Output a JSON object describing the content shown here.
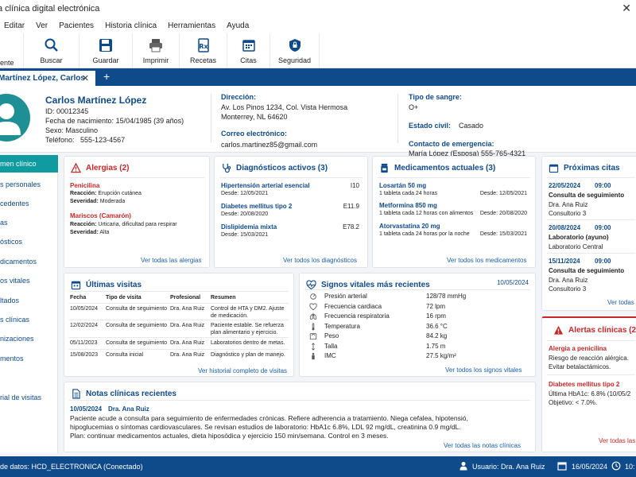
{
  "window": {
    "title": "a clínica digital electrónica",
    "close_glyph": "✕"
  },
  "menu": [
    "Editar",
    "Ver",
    "Pacientes",
    "Historia clínica",
    "Herramientas",
    "Ayuda"
  ],
  "toolbar": [
    {
      "label": "ente",
      "icon": "new-patient-icon"
    },
    {
      "label": "Buscar",
      "icon": "search-icon"
    },
    {
      "label": "Guardar",
      "icon": "save-icon"
    },
    {
      "label": "Imprimir",
      "icon": "printer-icon"
    },
    {
      "label": "Recetas",
      "icon": "prescription-icon"
    },
    {
      "label": "Citas",
      "icon": "calendar-icon"
    },
    {
      "label": "Seguridad",
      "icon": "shield-icon"
    }
  ],
  "tab": {
    "label": "Martínez López, Carlos",
    "close": "✕",
    "add": "+"
  },
  "patient": {
    "name": "Carlos Martínez López",
    "id_label": "ID:",
    "id": "00012345",
    "dob_label": "Fecha de nacimiento:",
    "dob": "15/04/1985 (39 años)",
    "sex_label": "Sexo:",
    "sex": "Masculino",
    "phone_label": "Teléfono:",
    "phone": "555-123-4567",
    "address_label": "Dirección:",
    "address1": "Av. Los Pinos 1234, Col. Vista Hermosa",
    "address2": "Monterrey, NL 64620",
    "email_label": "Correo electrónico:",
    "email": "carlos.martinez85@gmail.com",
    "blood_label": "Tipo de sangre:",
    "blood": "O+",
    "civil_label": "Estado civil:",
    "civil": "Casado",
    "emergency_label": "Contacto de emergencia:",
    "emergency": "María López (Esposa)  555-765-4321"
  },
  "sidebar": [
    "men clínico",
    "s personales",
    "cedentes",
    "as",
    "ósticos",
    "dicamentos",
    "os vitales",
    "ltados",
    "s clínicas",
    "nizaciones",
    "mentos",
    "rial de visitas"
  ],
  "allergies": {
    "title": "Alergias (2)",
    "items": [
      {
        "name": "Penicilina",
        "reaction_label": "Reacción:",
        "reaction": "Erupción cutánea",
        "severity_label": "Severidad:",
        "severity": "Moderada"
      },
      {
        "name": "Mariscos (Camarón)",
        "reaction_label": "Reacción:",
        "reaction": "Urticaria, dificultad para respirar",
        "severity_label": "Severidad:",
        "severity": "Alta"
      }
    ],
    "link": "Ver todas las alergias"
  },
  "diagnoses": {
    "title": "Diagnósticos activos (3)",
    "items": [
      {
        "name": "Hipertensión arterial esencial",
        "code": "I10",
        "since": "Desde: 12/05/2021"
      },
      {
        "name": "Diabetes mellitus tipo 2",
        "code": "E11.9",
        "since": "Desde: 20/08/2020"
      },
      {
        "name": "Dislipidemia mixta",
        "code": "E78.2",
        "since": "Desde: 15/03/2021"
      }
    ],
    "link": "Ver todos los diagnósticos"
  },
  "medications": {
    "title": "Medicamentos actuales (3)",
    "items": [
      {
        "name": "Losartán 50 mg",
        "dose": "1 tableta cada 24 horas",
        "since": "Desde: 12/05/2021"
      },
      {
        "name": "Metformina 850 mg",
        "dose": "1 tableta cada 12 horas con alimentos",
        "since": "Desde: 20/08/2020"
      },
      {
        "name": "Atorvastatina 20 mg",
        "dose": "1 tableta cada 24 horas por la noche",
        "since": "Desde: 15/03/2021"
      }
    ],
    "link": "Ver todos los medicamentos"
  },
  "appointments": {
    "title": "Próximas citas",
    "items": [
      {
        "date": "22/05/2024",
        "time": "09:00",
        "type": "Consulta de seguimiento",
        "doctor": "Dra. Ana Ruiz",
        "room": "Consultorio 3"
      },
      {
        "date": "20/08/2024",
        "time": "09:00",
        "type": "Laboratorio (ayuno)",
        "doctor": "Laboratorio Central",
        "room": ""
      },
      {
        "date": "15/11/2024",
        "time": "09:00",
        "type": "Consulta de seguimiento",
        "doctor": "Dra. Ana Ruiz",
        "room": "Consultorio 3"
      }
    ],
    "link": "Ver todas l"
  },
  "visits": {
    "title": "Últimas visitas",
    "headers": [
      "Fecha",
      "Tipo de visita",
      "Profesional",
      "Resumen"
    ],
    "rows": [
      [
        "10/05/2024",
        "Consulta de seguimiento",
        "Dra. Ana Ruiz",
        "Control de HTA y DM2. Ajuste de medicación."
      ],
      [
        "12/02/2024",
        "Consulta de seguimiento",
        "Dra. Ana Ruiz",
        "Paciente estable. Se refuerza plan alimentario y ejercicio."
      ],
      [
        "05/11/2023",
        "Consulta de seguimiento",
        "Dra. Ana Ruiz",
        "Laboratorios dentro de metas."
      ],
      [
        "15/08/2023",
        "Consulta inicial",
        "Dra. Ana Ruiz",
        "Diagnóstico y plan de manejo."
      ]
    ],
    "link": "Ver historial completo de visitas"
  },
  "vitals": {
    "title": "Signos vitales más recientes",
    "date": "10/05/2024",
    "items": [
      {
        "label": "Presión arterial",
        "value": "128/78 mmHg",
        "icon": "blood-pressure-icon"
      },
      {
        "label": "Frecuencia cardiaca",
        "value": "72 lpm",
        "icon": "heart-icon"
      },
      {
        "label": "Frecuencia respiratoria",
        "value": "16 rpm",
        "icon": "lungs-icon"
      },
      {
        "label": "Temperatura",
        "value": "36.6 °C",
        "icon": "thermometer-icon"
      },
      {
        "label": "Peso",
        "value": "84.2 kg",
        "icon": "scale-icon"
      },
      {
        "label": "Talla",
        "value": "1.75 m",
        "icon": "height-icon"
      },
      {
        "label": "IMC",
        "value": "27.5 kg/m²",
        "icon": "bmi-icon"
      }
    ],
    "link": "Ver todos los signos vitales"
  },
  "notes": {
    "title": "Notas clínicas recientes",
    "date": "10/05/2024",
    "author": "Dra. Ana Ruiz",
    "line1": "Paciente acude a consulta para seguimiento de enfermedades crónicas. Refiere adherencia a tratamiento. Niega cefalea, hipotensió,",
    "line2": "hipoglucemias o síntomas cardiovasculares. Se revisan estudios de laboratorio: HbA1c 6.8%, LDL 92 mg/dL, creatinina 0.9 mg/dL.",
    "line3": "Plan: continuar medicamentos actuales, dieta hiposódica y ejercicio 150 min/semana. Control en 3 meses.",
    "link": "Ver todas las notas clínicas"
  },
  "alerts": {
    "title": "Alertas clínicas (2)",
    "a1_title": "Alergia a penicilina",
    "a1_l1": "Riesgo de reacción alérgica.",
    "a1_l2": "Evitar betalactámicos.",
    "a2_title": "Diabetes mellitus tipo 2",
    "a2_l1": "Última HbA1c: 6.8% (10/05/2",
    "a2_l2": "Objetivo: < 7.0%.",
    "link": "Ver todas las"
  },
  "status": {
    "db": "de datos: HCD_ELECTRONICA (Conectado)",
    "user": "Usuario: Dra. Ana Ruiz",
    "date": "16/05/2024",
    "time": "10:"
  },
  "colors": {
    "primary": "#0f4a8a",
    "accent": "#0f9ba0",
    "alert": "#c62828"
  }
}
